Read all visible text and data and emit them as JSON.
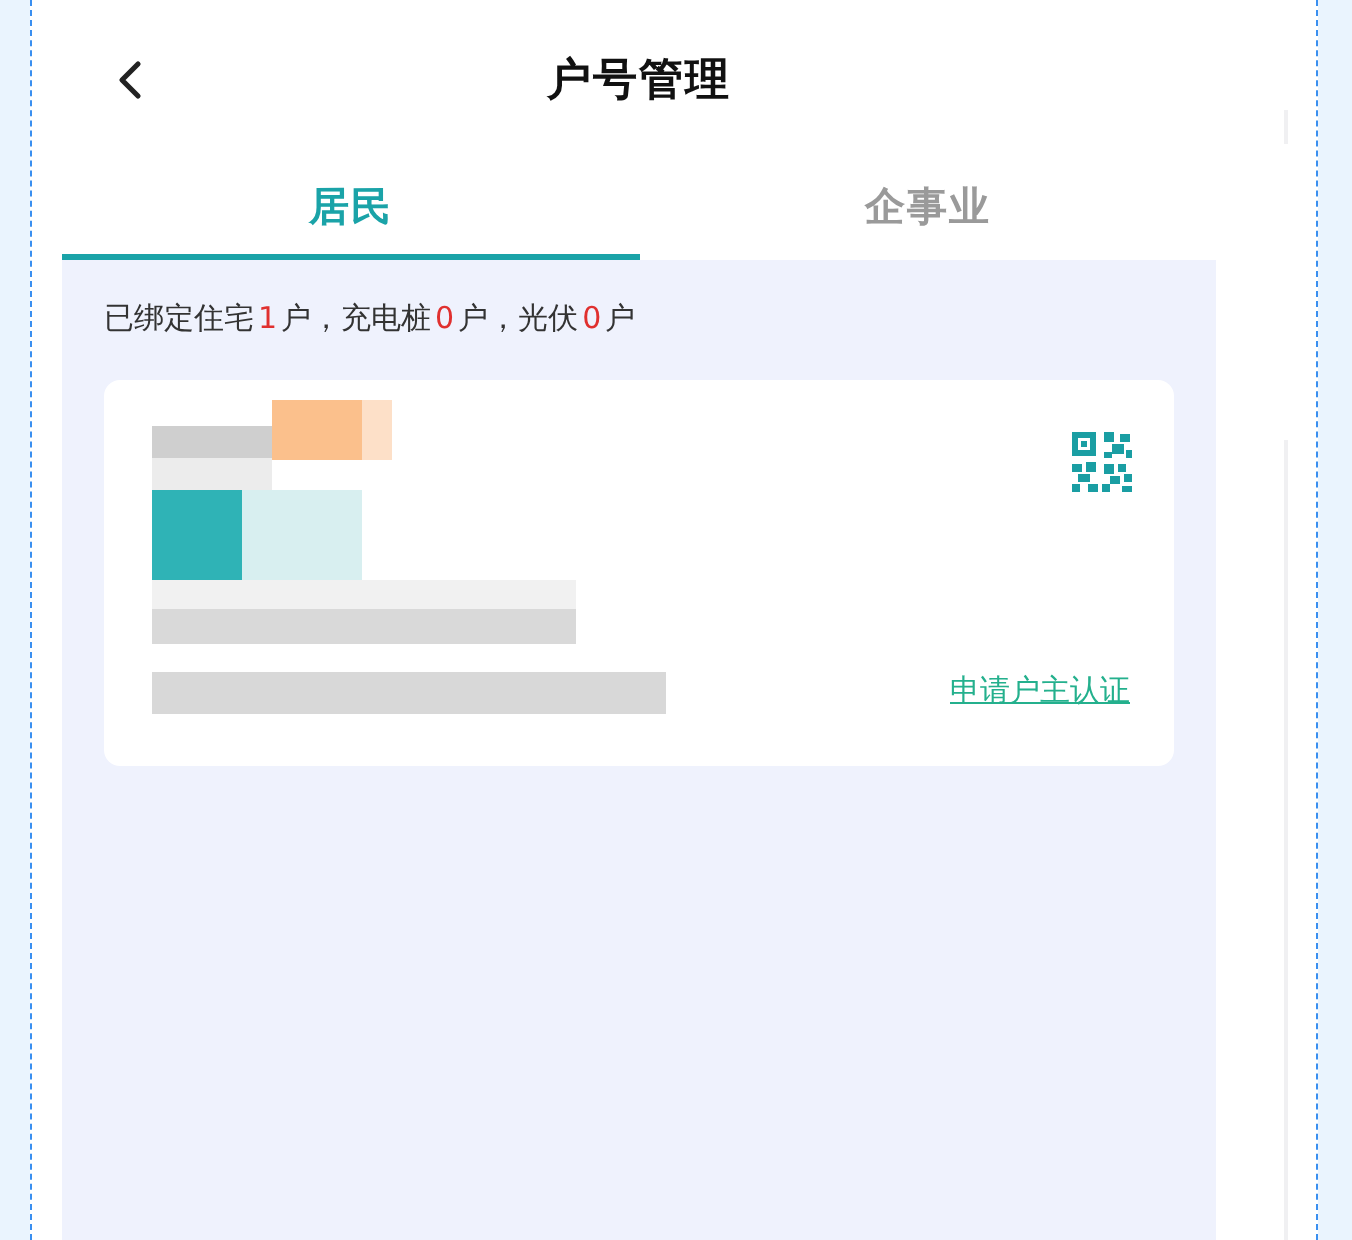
{
  "header": {
    "title": "户号管理"
  },
  "tabs": [
    {
      "label": "居民",
      "selected": true
    },
    {
      "label": "企事业",
      "selected": false
    }
  ],
  "summary": {
    "segments": [
      {
        "text": "已绑定住宅",
        "kind": "plain"
      },
      {
        "text": "1",
        "kind": "count"
      },
      {
        "text": "户，充电桩",
        "kind": "plain"
      },
      {
        "text": "0",
        "kind": "count"
      },
      {
        "text": "户，光伏",
        "kind": "plain"
      },
      {
        "text": "0",
        "kind": "count"
      },
      {
        "text": "户",
        "kind": "plain"
      }
    ]
  },
  "account_card": {
    "link": "申请户主认证"
  }
}
